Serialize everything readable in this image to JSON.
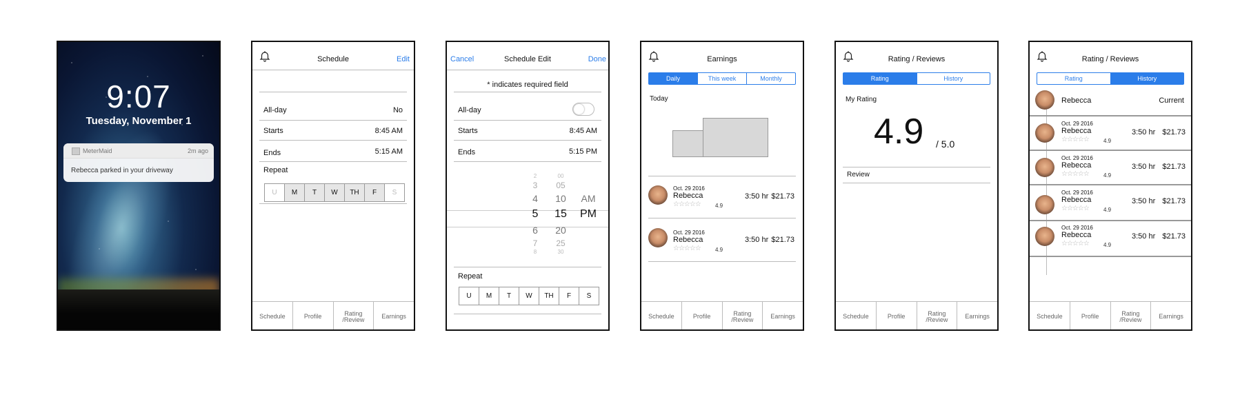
{
  "lock": {
    "time": "9:07",
    "date": "Tuesday, November 1",
    "notification": {
      "app": "MeterMaid",
      "ago": "2m ago",
      "message": "Rebecca parked in your driveway"
    }
  },
  "tabs": [
    "Schedule",
    "Profile",
    "Rating /Review",
    "Earnings"
  ],
  "schedule": {
    "title": "Schedule",
    "edit": "Edit",
    "rows": [
      {
        "label": "All-day",
        "value": "No"
      },
      {
        "label": "Starts",
        "value": "8:45 AM"
      },
      {
        "label": "Ends",
        "value": "5:15 AM"
      }
    ],
    "repeat_label": "Repeat",
    "days": [
      "U",
      "M",
      "T",
      "W",
      "TH",
      "F",
      "S"
    ]
  },
  "schedule_edit": {
    "cancel": "Cancel",
    "title": "Schedule Edit",
    "done": "Done",
    "required_note": "* indicates required field",
    "allday_label": "All-day",
    "starts_label": "Starts",
    "starts_value": "8:45 AM",
    "ends_label": "Ends",
    "ends_value": "5:15 PM",
    "picker": {
      "hours": [
        "2",
        "3",
        "4",
        "5",
        "6",
        "7",
        "8"
      ],
      "minutes": [
        "00",
        "05",
        "10",
        "15",
        "20",
        "25",
        "30"
      ],
      "ampm": [
        "AM",
        "PM"
      ]
    },
    "repeat_label": "Repeat",
    "days": [
      "U",
      "M",
      "T",
      "W",
      "TH",
      "F",
      "S"
    ]
  },
  "earnings": {
    "title": "Earnings",
    "segments": [
      "Daily",
      "This week",
      "Monthly"
    ],
    "period_label": "Today",
    "entries": [
      {
        "date": "Oct. 29 2016",
        "name": "Rebecca",
        "rating": "4.9",
        "hours": "3:50 hr",
        "amount": "$21.73"
      },
      {
        "date": "Oct. 29 2016",
        "name": "Rebecca",
        "rating": "4.9",
        "hours": "3:50 hr",
        "amount": "$21.73"
      }
    ]
  },
  "rating": {
    "title": "Rating / Reviews",
    "segments": [
      "Rating",
      "History"
    ],
    "my_rating_label": "My Rating",
    "score": "4.9",
    "out_of": "/  5.0",
    "review_label": "Review"
  },
  "history": {
    "title": "Rating / Reviews",
    "segments": [
      "Rating",
      "History"
    ],
    "current": {
      "name": "Rebecca",
      "status": "Current"
    },
    "entries": [
      {
        "date": "Oct. 29 2016",
        "name": "Rebecca",
        "rating": "4.9",
        "hours": "3:50 hr",
        "amount": "$21.73"
      },
      {
        "date": "Oct. 29 2016",
        "name": "Rebecca",
        "rating": "4.9",
        "hours": "3:50 hr",
        "amount": "$21.73"
      },
      {
        "date": "Oct. 29 2016",
        "name": "Rebecca",
        "rating": "4.9",
        "hours": "3:50 hr",
        "amount": "$21.73"
      },
      {
        "date": "Oct. 29 2016",
        "name": "Rebecca",
        "rating": "4.9",
        "hours": "3:50 hr",
        "amount": "$21.73"
      }
    ]
  },
  "icons": {
    "bell": "bell-icon",
    "star": "star-icon",
    "avatar": "avatar-photo"
  },
  "colors": {
    "accent": "#2b7de9"
  }
}
